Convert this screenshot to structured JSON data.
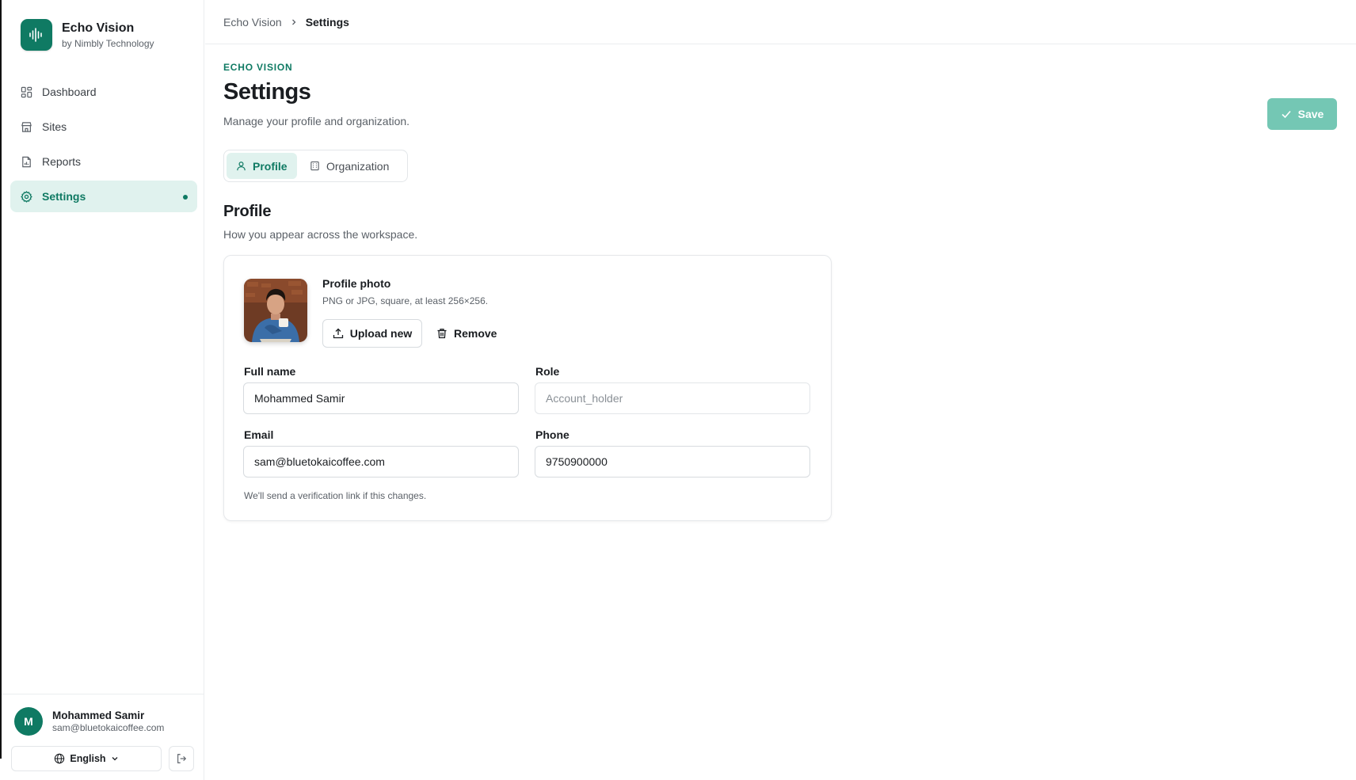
{
  "brand": {
    "name": "Echo Vision",
    "subtitle": "by Nimbly Technology"
  },
  "nav": {
    "items": [
      {
        "label": "Dashboard",
        "icon": "dashboard-icon"
      },
      {
        "label": "Sites",
        "icon": "store-icon"
      },
      {
        "label": "Reports",
        "icon": "report-icon"
      },
      {
        "label": "Settings",
        "icon": "gear-icon",
        "active": true
      }
    ]
  },
  "user": {
    "initial": "M",
    "name": "Mohammed Samir",
    "email": "sam@bluetokaicoffee.com"
  },
  "language": {
    "selected": "English"
  },
  "breadcrumb": {
    "parent": "Echo Vision",
    "current": "Settings"
  },
  "page": {
    "eyebrow": "ECHO VISION",
    "title": "Settings",
    "subtitle": "Manage your profile and organization.",
    "save_label": "Save"
  },
  "tabs": [
    {
      "label": "Profile",
      "icon": "user-icon",
      "active": true
    },
    {
      "label": "Organization",
      "icon": "building-icon"
    }
  ],
  "profile": {
    "title": "Profile",
    "subtitle": "How you appear across the workspace.",
    "photo": {
      "title": "Profile photo",
      "hint": "PNG or JPG, square, at least 256×256.",
      "upload_label": "Upload new",
      "remove_label": "Remove"
    },
    "fields": {
      "full_name": {
        "label": "Full name",
        "value": "Mohammed Samir"
      },
      "role": {
        "label": "Role",
        "placeholder": "Account_holder"
      },
      "email": {
        "label": "Email",
        "value": "sam@bluetokaicoffee.com",
        "hint": "We'll send a verification link if this changes."
      },
      "phone": {
        "label": "Phone",
        "value": "9750900000"
      }
    }
  },
  "colors": {
    "accent": "#0f7a63",
    "accent_light": "#e0f2ee",
    "save_disabled": "#74c7b4"
  }
}
